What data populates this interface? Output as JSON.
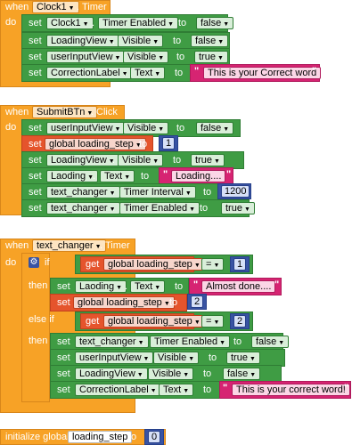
{
  "blocks": {
    "kw_when": "when",
    "kw_do": "do",
    "kw_set": "set",
    "kw_to": "to",
    "kw_get": "get",
    "kw_if": "if",
    "kw_then": "then",
    "kw_elseif": "else if",
    "kw_initialize_global": "initialize global",
    "eq_sign": "=",
    "dot": ".",
    "quote": "\"",
    "clock": {
      "component": "Clock1",
      "event": "Timer",
      "rows": [
        {
          "component": "Clock1",
          "property": "Timer Enabled",
          "value": "false"
        },
        {
          "component": "LoadingView",
          "property": "Visible",
          "value": "false"
        },
        {
          "component": "userInputView",
          "property": "Visible",
          "value": "true"
        },
        {
          "component": "CorrectionLabel",
          "property": "Text",
          "value": "This is your Correct word"
        }
      ]
    },
    "submit": {
      "component": "SubmitBTn",
      "event": "Click",
      "rows": [
        {
          "component": "userInputView",
          "property": "Visible",
          "value": "false"
        },
        {
          "global": "global loading_step",
          "value": "1"
        },
        {
          "component": "LoadingView",
          "property": "Visible",
          "value": "true"
        },
        {
          "component": "Laoding",
          "property": "Text",
          "value": "Loading...."
        },
        {
          "component": "text_changer",
          "property": "Timer Interval",
          "value": "1200"
        },
        {
          "component": "text_changer",
          "property": "Timer Enabled",
          "value": "true"
        }
      ]
    },
    "changer": {
      "component": "text_changer",
      "event": "Timer",
      "if1": {
        "variable": "global loading_step",
        "value": "1"
      },
      "then1": [
        {
          "component": "Laoding",
          "property": "Text",
          "value": "Almost done...."
        },
        {
          "global": "global loading_step",
          "value": "2"
        }
      ],
      "if2": {
        "variable": "global loading_step",
        "value": "2"
      },
      "then2": [
        {
          "component": "text_changer",
          "property": "Timer Enabled",
          "value": "false"
        },
        {
          "component": "userInputView",
          "property": "Visible",
          "value": "true"
        },
        {
          "component": "LoadingView",
          "property": "Visible",
          "value": "false"
        },
        {
          "component": "CorrectionLabel",
          "property": "Text",
          "value": "This is your correct word!"
        }
      ]
    },
    "init": {
      "name": "loading_step",
      "value": "0"
    }
  }
}
